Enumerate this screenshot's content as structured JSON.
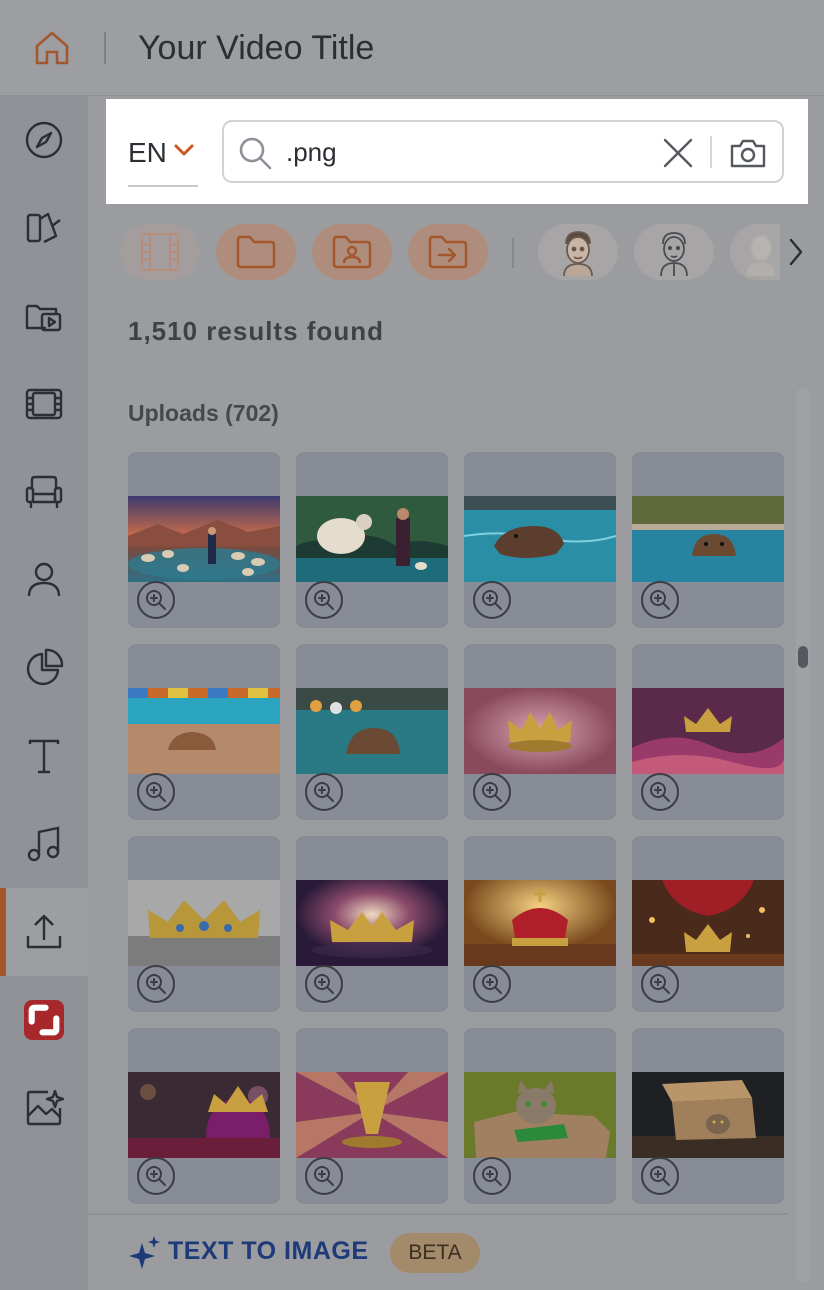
{
  "topbar": {
    "title": "Your Video Title"
  },
  "nav": {
    "items": [
      {
        "icon": "compass-icon"
      },
      {
        "icon": "templates-icon"
      },
      {
        "icon": "media-folder-icon"
      },
      {
        "icon": "film-strip-icon"
      },
      {
        "icon": "chair-icon"
      },
      {
        "icon": "person-icon"
      },
      {
        "icon": "pie-chart-icon"
      },
      {
        "icon": "text-icon"
      },
      {
        "icon": "music-note-icon"
      },
      {
        "icon": "upload-icon",
        "active": true
      },
      {
        "icon": "brand-app-icon"
      },
      {
        "icon": "ai-image-icon"
      }
    ]
  },
  "search": {
    "language": "EN",
    "query": ".png"
  },
  "filters": [
    "video",
    "folder",
    "user-folder",
    "import-folder",
    "character-1",
    "character-2",
    "character-3"
  ],
  "results": {
    "count_label": "1,510 results found",
    "section_label": "Uploads (702)"
  },
  "grid": {
    "items": [
      {
        "subject": "man in suit with sheep on lake"
      },
      {
        "subject": "man and sheep in forest"
      },
      {
        "subject": "capybara swimming"
      },
      {
        "subject": "capybara in pool"
      },
      {
        "subject": "capybara on poolside"
      },
      {
        "subject": "capybara in water"
      },
      {
        "subject": "golden crown pink"
      },
      {
        "subject": "crown on silk"
      },
      {
        "subject": "jeweled crown"
      },
      {
        "subject": "crown sparkles"
      },
      {
        "subject": "red velvet crown"
      },
      {
        "subject": "crown red curtain"
      },
      {
        "subject": "purple crown"
      },
      {
        "subject": "golden trophy crown"
      },
      {
        "subject": "cat in box"
      },
      {
        "subject": "cat in cardboard box"
      }
    ]
  },
  "bottom": {
    "tti_label": "TEXT TO IMAGE",
    "beta_label": "BETA"
  },
  "colors": {
    "accent": "#a4572d",
    "brand_blue": "#1e3a78",
    "badge_red": "#a6282a"
  }
}
